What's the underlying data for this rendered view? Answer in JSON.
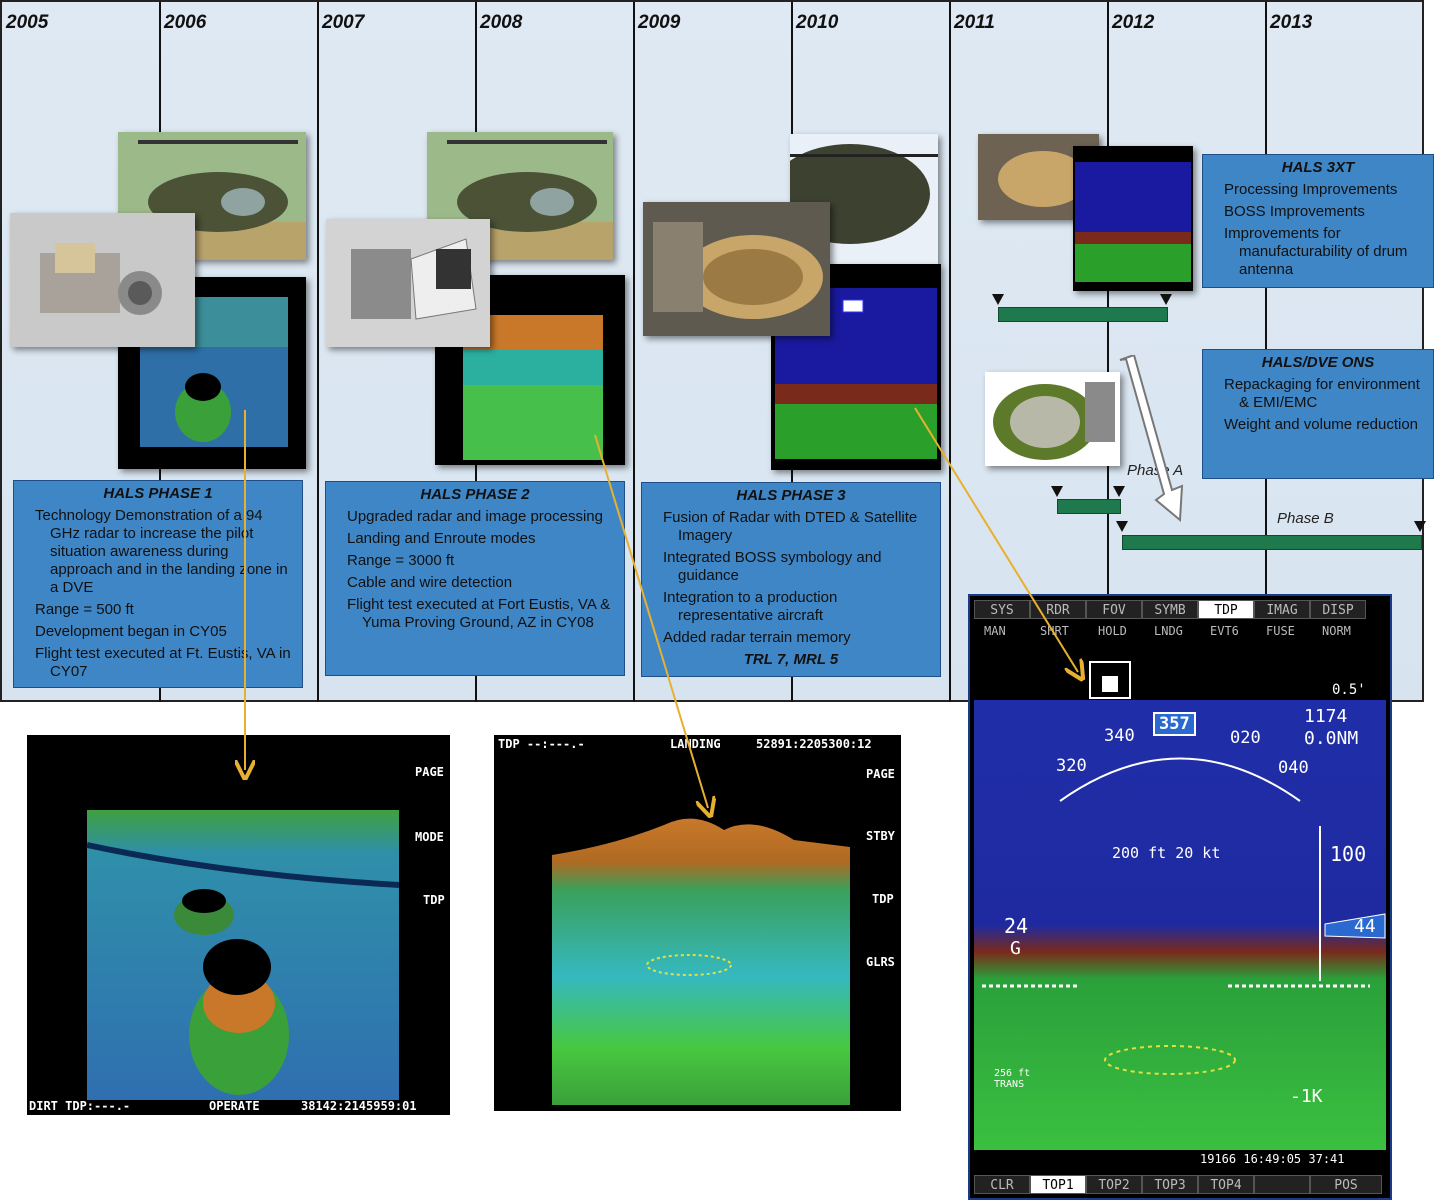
{
  "years": [
    "2005",
    "2006",
    "2007",
    "2008",
    "2009",
    "2010",
    "2011",
    "2012",
    "2013"
  ],
  "phase1": {
    "title": "HALS PHASE 1",
    "items": [
      "Technology Demonstration of a 94 GHz radar to increase the pilot situation awareness during approach and in the landing zone in a DVE",
      "Range = 500 ft",
      "Development began in CY05",
      "Flight test executed at Ft. Eustis, VA in CY07"
    ]
  },
  "phase2": {
    "title": "HALS PHASE 2",
    "items": [
      "Upgraded radar and image processing",
      "Landing and Enroute modes",
      "Range = 3000 ft",
      "Cable and wire detection",
      "Flight test executed at Fort Eustis, VA & Yuma Proving Ground, AZ in CY08"
    ]
  },
  "phase3": {
    "title": "HALS PHASE 3",
    "items": [
      "Fusion of Radar with DTED & Satellite Imagery",
      "Integrated BOSS symbology and guidance",
      "Integration to a production representative aircraft",
      "Added radar terrain memory"
    ],
    "footer": "TRL 7, MRL 5"
  },
  "hals3xt": {
    "title": "HALS 3XT",
    "items": [
      "Processing Improvements",
      "BOSS Improvements",
      "Improvements for manufacturability of drum antenna"
    ]
  },
  "halsdve": {
    "title": "HALS/DVE ONS",
    "items": [
      "Repackaging for environment & EMI/EMC",
      "Weight and volume reduction"
    ]
  },
  "phase_a_label": "Phase A",
  "phase_b_label": "Phase B",
  "radar1": {
    "side_labels": [
      "PAGE",
      "MODE",
      "TDP"
    ],
    "footer_left": "DIRT TDP:---.-",
    "footer_mid": "OPERATE",
    "footer_right": "38142:2145959:01"
  },
  "radar2": {
    "header_left": "TDP --:---.-",
    "header_mid": "LANDING",
    "header_right": "52891:2205300:12",
    "side_labels": [
      "PAGE",
      "STBY",
      "TDP",
      "GLRS"
    ]
  },
  "hud": {
    "tabs": [
      "SYS",
      "RDR",
      "FOV",
      "SYMB",
      "TDP",
      "IMAG",
      "DISP"
    ],
    "active_tab": "TDP",
    "subtabs": [
      "MAN",
      "SHRT",
      "HOLD",
      "LNDG",
      "EVT6",
      "FUSE",
      "NORM"
    ],
    "zoom": "0.5'",
    "heading": "357",
    "heading_ticks": [
      "320",
      "340",
      "020",
      "040"
    ],
    "alt_top": "1174",
    "range": "0.0NM",
    "speed_readout": "200 ft  20 kt",
    "scale_right": "100",
    "left_readout": "24",
    "left_sub": "G",
    "right_tag": "44",
    "bottom_left": "256 ft TRANS",
    "bottom_right": "-1K",
    "timestamp": "19166 16:49:05 37:41",
    "bottom_tabs": [
      "CLR",
      "TOP1",
      "TOP2",
      "TOP3",
      "TOP4",
      "",
      "POS"
    ],
    "active_bottom": "TOP1"
  },
  "colors": {
    "box_blue": "#3f86c6",
    "bar_green": "#1e7a4d",
    "arrow_orange": "#e8b030",
    "timeline_bg": "#d7e4f0"
  }
}
